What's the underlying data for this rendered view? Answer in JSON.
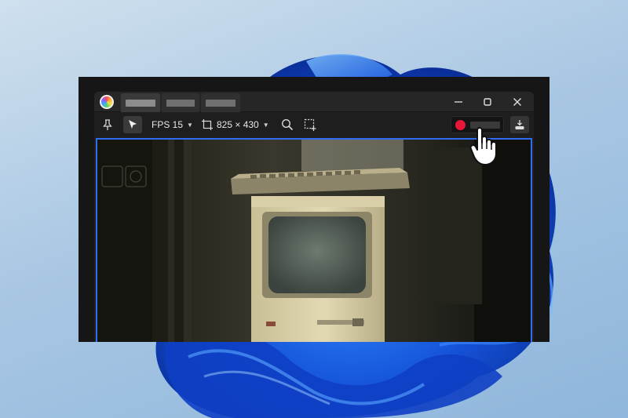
{
  "titlebar": {
    "tabs": [
      {
        "active": true
      },
      {
        "active": false
      },
      {
        "active": false
      }
    ],
    "icons": {
      "minimize": "minimize-icon",
      "maximize": "maximize-icon",
      "close": "close-icon"
    }
  },
  "toolbar": {
    "pin_icon": "pin-icon",
    "select_icon": "cursor-arrow-icon",
    "fps_label": "FPS 15",
    "size_label": "825 × 430",
    "zoom_icon": "search-icon",
    "region_icon": "region-select-icon",
    "record_color": "#e8173a",
    "save_icon": "download-icon"
  },
  "capture": {
    "border_color": "#2f6cf2"
  }
}
